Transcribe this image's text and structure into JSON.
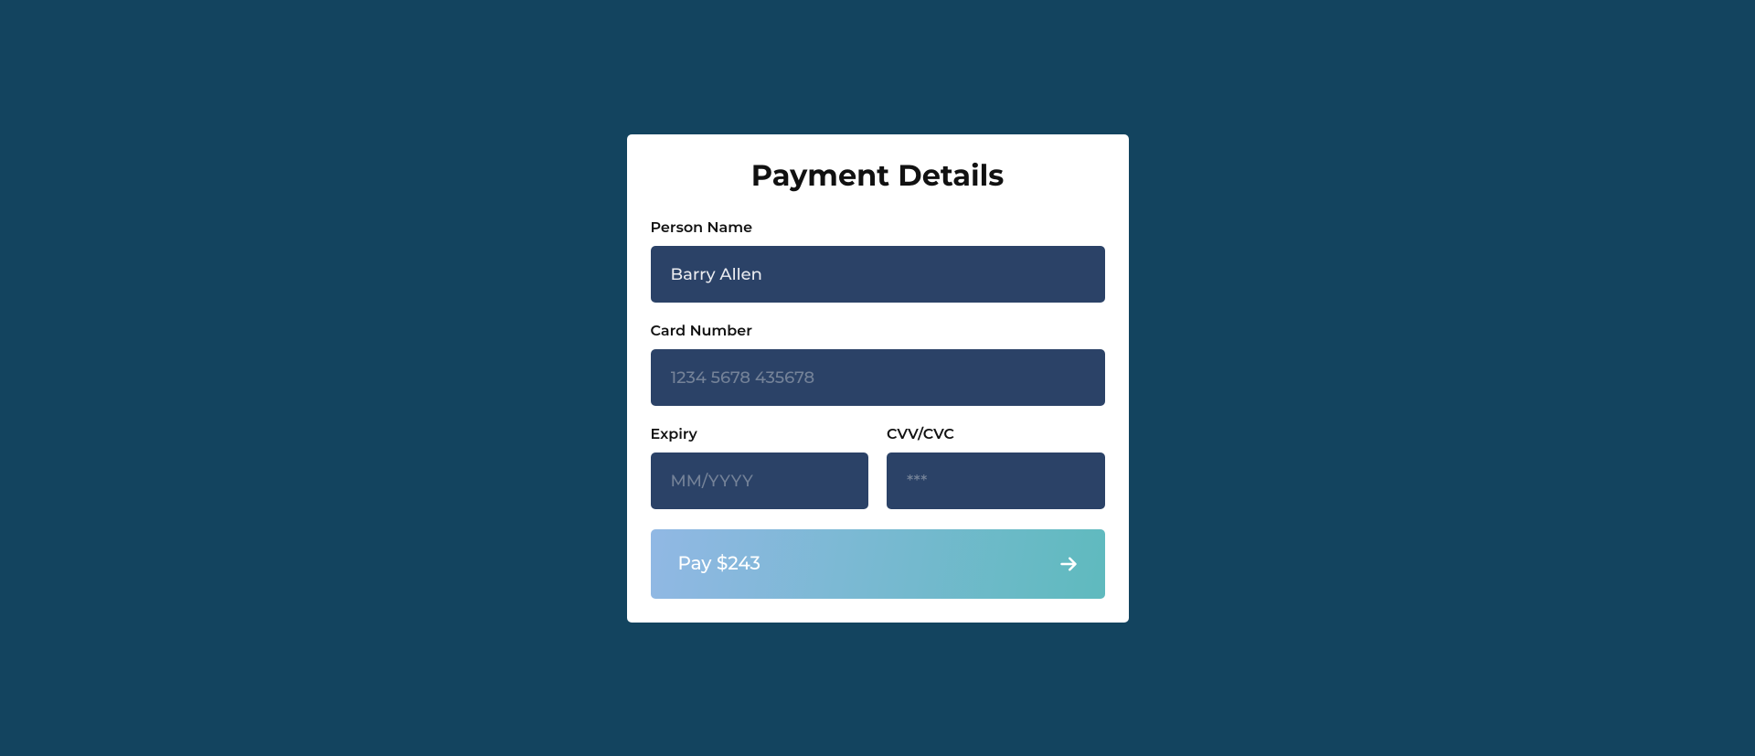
{
  "title": "Payment Details",
  "fields": {
    "personName": {
      "label": "Person Name",
      "value": "Barry Allen",
      "placeholder": ""
    },
    "cardNumber": {
      "label": "Card Number",
      "value": "",
      "placeholder": "1234 5678 435678"
    },
    "expiry": {
      "label": "Expiry",
      "value": "",
      "placeholder": "MM/YYYY"
    },
    "cvv": {
      "label": "CVV/CVC",
      "value": "",
      "placeholder": "***"
    }
  },
  "payButton": {
    "label": "Pay $243"
  }
}
